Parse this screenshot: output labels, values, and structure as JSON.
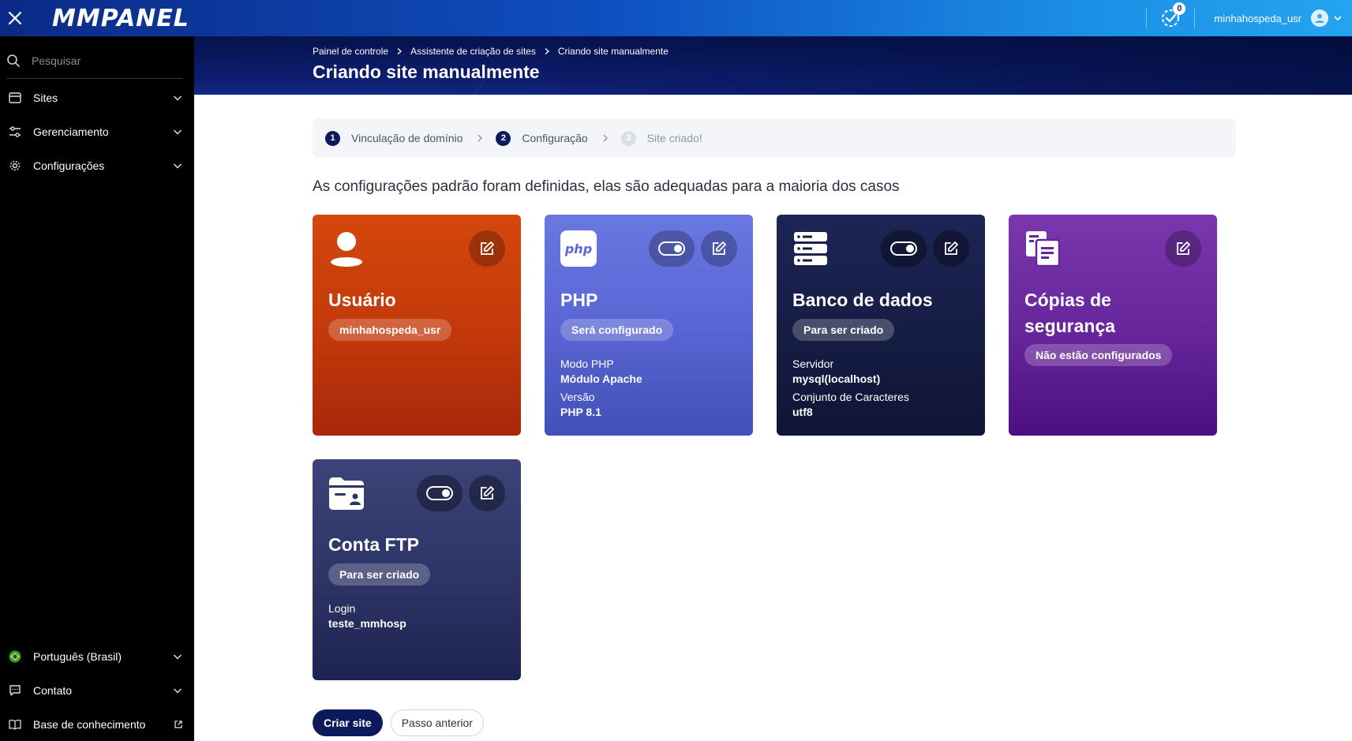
{
  "app": {
    "logo": "MMPANEL",
    "user_name": "minhahospeda_usr",
    "task_count": "0"
  },
  "sidebar": {
    "search_placeholder": "Pesquisar",
    "items": [
      {
        "label": "Sites",
        "icon": "browser-window-icon"
      },
      {
        "label": "Gerenciamento",
        "icon": "sliders-icon"
      },
      {
        "label": "Configurações",
        "icon": "gear-icon"
      }
    ],
    "bottom_items": [
      {
        "label": "Português (Brasil)",
        "icon": "brazil-flag-icon"
      },
      {
        "label": "Contato",
        "icon": "chat-icon"
      },
      {
        "label": "Base de conhecimento",
        "icon": "book-icon"
      }
    ]
  },
  "header": {
    "breadcrumb": [
      "Painel de controle",
      "Assistente de criação de sites",
      "Criando site manualmente"
    ],
    "title": "Criando site manualmente"
  },
  "stepper": {
    "steps": [
      {
        "num": "1",
        "label": "Vinculação de domínio"
      },
      {
        "num": "2",
        "label": "Configuração"
      },
      {
        "num": "3",
        "label": "Site criado!"
      }
    ]
  },
  "intro": "As configurações padrão foram definidas, elas são adequadas para a maioria dos casos",
  "cards": {
    "user": {
      "title": "Usuário",
      "badge": "minhahospeda_usr"
    },
    "php": {
      "logo": "php",
      "title": "PHP",
      "badge": "Será configurado",
      "details": [
        {
          "label": "Modo PHP",
          "value": "Módulo Apache"
        },
        {
          "label": "Versão",
          "value": "PHP 8.1"
        }
      ]
    },
    "db": {
      "title": "Banco de dados",
      "badge": "Para ser criado",
      "details": [
        {
          "label": "Servidor",
          "value": "mysql(localhost)"
        },
        {
          "label": "Conjunto de Caracteres",
          "value": "utf8"
        }
      ]
    },
    "backup": {
      "title": "Cópias de segurança",
      "badge": "Não estão configurados"
    },
    "ftp": {
      "title": "Conta FTP",
      "badge": "Para ser criado",
      "details": [
        {
          "label": "Login",
          "value": "teste_mmhosp"
        }
      ]
    }
  },
  "buttons": {
    "create": "Criar site",
    "previous": "Passo anterior"
  },
  "colors": {
    "topbar_start": "#0b2a86",
    "topbar_end": "#24a4f0",
    "sidebar": "#000000",
    "primary": "#0c1a5c",
    "card_user": "#c2380a",
    "card_php": "#5966d4",
    "card_db": "#151c42",
    "card_backup": "#66259b",
    "card_ftp": "#2d3466"
  }
}
